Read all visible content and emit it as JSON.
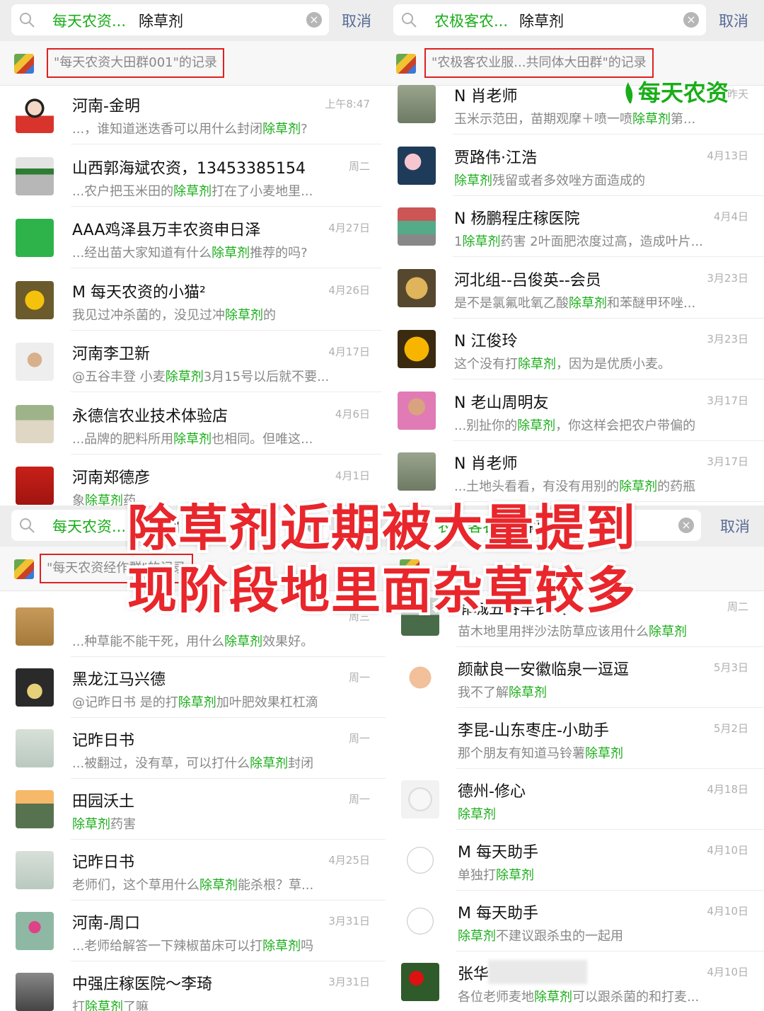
{
  "colors": {
    "highlight": "#1aad19",
    "overlay": "#e8262b",
    "cancel": "#576b95"
  },
  "panels": [
    {
      "search_tag": "每天农资...",
      "keyword": "除草剂",
      "cancel": "取消",
      "record": "\"每天农资大田群001\"的记录",
      "rows": [
        {
          "name": "河南-金明",
          "time": "上午8:47",
          "pre": "...，谁知道迷迭香可以用什么封闭",
          "hl": "除草剂",
          "post": "?",
          "avatar": "person-red"
        },
        {
          "name": "山西郭海斌农资，13453385154",
          "time": "周二",
          "pre": "...农户把玉米田的",
          "hl": "除草剂",
          "post": "打在了小麦地里...",
          "avatar": "shop"
        },
        {
          "name": "AAA鸡泽县万丰农资申日泽",
          "time": "4月27日",
          "pre": "...经出苗大家知道有什么",
          "hl": "除草剂",
          "post": "推荐的吗?",
          "avatar": "green-nong"
        },
        {
          "name": "M 每天农资的小猫²",
          "time": "4月26日",
          "pre": "我见过冲杀菌的，没见过冲",
          "hl": "除草剂",
          "post": "的",
          "avatar": "flower"
        },
        {
          "name": "河南李卫新",
          "time": "4月17日",
          "pre": "@五谷丰登 小麦",
          "hl": "除草剂",
          "post": "3月15号以后就不要...",
          "avatar": "person"
        },
        {
          "name": "永德信农业技术体验店",
          "time": "4月6日",
          "pre": "...品牌的肥料所用",
          "hl": "除草剂",
          "post": "也相同。但唯这...",
          "avatar": "outdoor"
        },
        {
          "name": "河南郑德彦",
          "time": "4月1日",
          "pre": "象",
          "hl": "除草剂",
          "post": "药",
          "avatar": "red-flag"
        }
      ]
    },
    {
      "search_tag": "农极客农...",
      "keyword": "除草剂",
      "cancel": "取消",
      "record": "\"农极客农业服...共同体大田群\"的记录",
      "rows": [
        {
          "name": "N 肖老师",
          "time": "昨天",
          "pre": "玉米示范田，苗期观摩＋喷一喷",
          "hl": "除草剂",
          "post": "第...",
          "avatar": "calligraphy"
        },
        {
          "name": "贾路伟·江浩",
          "time": "4月13日",
          "pre": "",
          "hl": "除草剂",
          "post": "残留或者多效唑方面造成的",
          "avatar": "lotus"
        },
        {
          "name": "N 杨鹏程庄稼医院",
          "time": "4月4日",
          "pre": "1",
          "hl": "除草剂",
          "post": "药害 2叶面肥浓度过高，造成叶片...",
          "avatar": "storefront"
        },
        {
          "name": "河北组--吕俊英--会员",
          "time": "3月23日",
          "pre": "是不是氯氟吡氧乙酸",
          "hl": "除草剂",
          "post": "和苯醚甲环唑...",
          "avatar": "stone"
        },
        {
          "name": "N 江俊玲",
          "time": "3月23日",
          "pre": "这个没有打",
          "hl": "除草剂",
          "post": "，因为是优质小麦。",
          "avatar": "yellow-fruit"
        },
        {
          "name": "N 老山周明友",
          "time": "3月17日",
          "pre": "...别扯你的",
          "hl": "除草剂",
          "post": "，你这样会把农户带偏的",
          "avatar": "person-pink"
        },
        {
          "name": "N 肖老师",
          "time": "3月17日",
          "pre": "...土地头看看，有没有用别的",
          "hl": "除草剂",
          "post": "的药瓶",
          "avatar": "calligraphy"
        }
      ]
    },
    {
      "search_tag": "每天农资...",
      "keyword": "除草剂",
      "cancel": "取消",
      "record": "\"每天农资经作群\"的记录",
      "rows": [
        {
          "name": "",
          "time": "周三",
          "pre": "...种草能不能干死，用什么",
          "hl": "除草剂",
          "post": "效果好。",
          "avatar": "calligraphy-brown"
        },
        {
          "name": "黑龙江马兴德",
          "time": "周一",
          "pre": "@记昨日书 是的打",
          "hl": "除草剂",
          "post": "加叶肥效果杠杠滴",
          "avatar": "tea"
        },
        {
          "name": "记昨日书",
          "time": "周一",
          "pre": "...被翻过，没有草，可以打什么",
          "hl": "除草剂",
          "post": "封闭",
          "avatar": "misty"
        },
        {
          "name": "田园沃土",
          "time": "周一",
          "pre": "",
          "hl": "除草剂",
          "post": "药害",
          "avatar": "mountain"
        },
        {
          "name": "记昨日书",
          "time": "4月25日",
          "pre": "老师们，这个草用什么",
          "hl": "除草剂",
          "post": "能杀根？草...",
          "avatar": "misty"
        },
        {
          "name": "河南-周口",
          "time": "3月31日",
          "pre": "...老师给解答一下辣椒苗床可以打",
          "hl": "除草剂",
          "post": "吗",
          "avatar": "person-outdoor"
        },
        {
          "name": "中强庄稼医院～李琦",
          "time": "3月31日",
          "pre": "打",
          "hl": "除草剂",
          "post": "了嘛",
          "avatar": "guitar"
        }
      ]
    },
    {
      "search_tag": "农极客农...",
      "keyword": "除草剂",
      "cancel": "取消",
      "record": "",
      "rows": [
        {
          "name": "郓城五谷丰农资",
          "time": "周二",
          "pre": "苗木地里用拌沙法防草应该用什么",
          "hl": "除草剂",
          "post": "",
          "avatar": "lake"
        },
        {
          "name": "颜献良一安徽临泉一逗逗",
          "time": "5月3日",
          "pre": "我不了解",
          "hl": "除草剂",
          "post": "",
          "avatar": "cartoon"
        },
        {
          "name": "李昆-山东枣庄-小助手",
          "time": "5月2日",
          "pre": "那个朋友有知道马铃薯",
          "hl": "除草剂",
          "post": "",
          "avatar": "text-white"
        },
        {
          "name": "德州-修心",
          "time": "4月18日",
          "pre": "",
          "hl": "除草剂",
          "post": "",
          "avatar": "plate"
        },
        {
          "name": "M 每天助手",
          "time": "4月10日",
          "pre": "单独打",
          "hl": "除草剂",
          "post": "",
          "avatar": "helper"
        },
        {
          "name": "M 每天助手",
          "time": "4月10日",
          "pre": "",
          "hl": "除草剂",
          "post": "不建议跟杀虫的一起用",
          "avatar": "helper"
        },
        {
          "name": "张华",
          "time": "4月10日",
          "pre": "各位老师麦地",
          "hl": "除草剂",
          "post": "可以跟杀菌的和打麦...",
          "avatar": "red-flowers"
        }
      ]
    }
  ],
  "overlay": {
    "line1": "除草剂近期被大量提到",
    "line2": "现阶段地里面杂草较多"
  },
  "brand": "每天农资"
}
